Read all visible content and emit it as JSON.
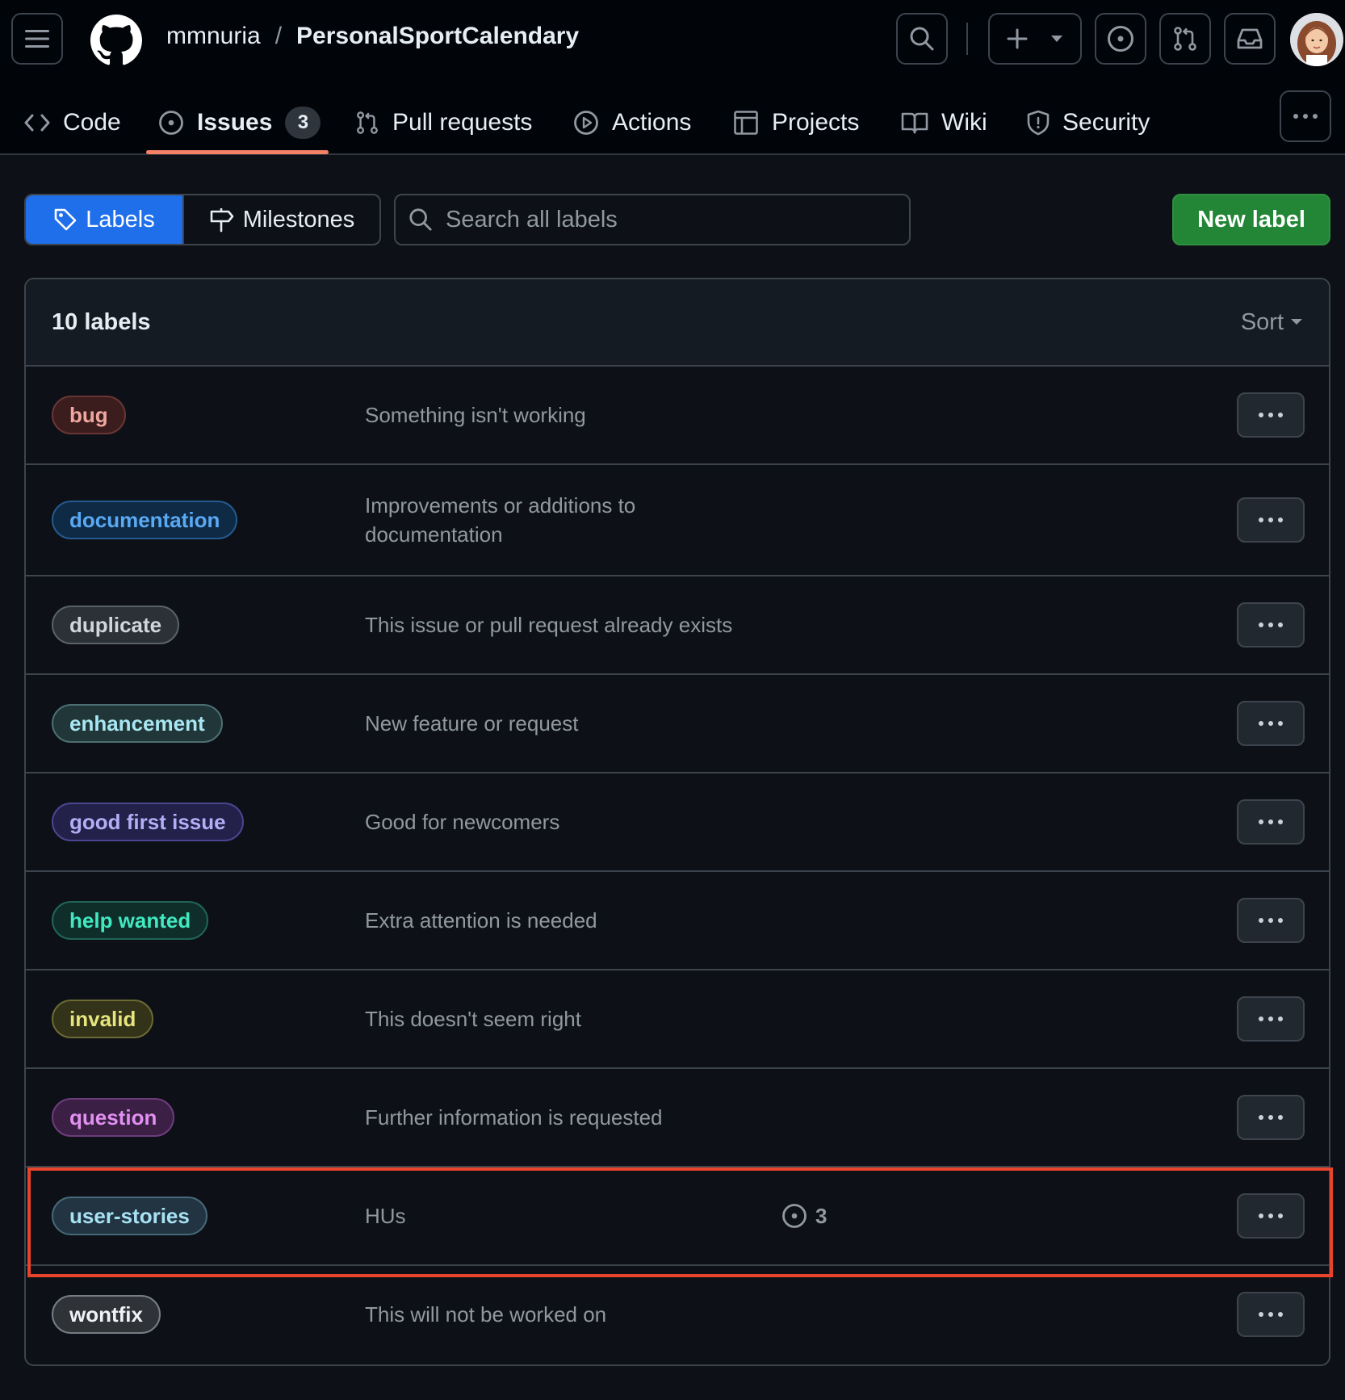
{
  "header": {
    "owner": "mmnuria",
    "separator": "/",
    "repo": "PersonalSportCalendary",
    "icons": [
      "hamburger-icon",
      "github-logo-icon",
      "search-icon",
      "plus-icon",
      "caret-down-icon",
      "issue-opened-icon",
      "git-pull-request-icon",
      "inbox-icon"
    ]
  },
  "tabs": [
    {
      "label": "Code",
      "icon": "code-icon"
    },
    {
      "label": "Issues",
      "icon": "issue-opened-icon",
      "count": "3"
    },
    {
      "label": "Pull requests",
      "icon": "git-pull-request-icon"
    },
    {
      "label": "Actions",
      "icon": "play-icon"
    },
    {
      "label": "Projects",
      "icon": "table-icon"
    },
    {
      "label": "Wiki",
      "icon": "book-icon"
    },
    {
      "label": "Security",
      "icon": "shield-icon"
    }
  ],
  "subnav": {
    "labels": "Labels",
    "milestones": "Milestones"
  },
  "search": {
    "placeholder": "Search all labels"
  },
  "new_label_button": "New label",
  "list": {
    "title": "10 labels",
    "sort": "Sort",
    "labels": [
      {
        "name": "bug",
        "description": "Something isn't working",
        "fg": "#f1a7a0",
        "bg": "#3b1d1e",
        "border": "#6b3536"
      },
      {
        "name": "documentation",
        "description": "Improvements or additions to documentation",
        "fg": "#5aa9f4",
        "bg": "#0f2a45",
        "border": "#245a8f"
      },
      {
        "name": "duplicate",
        "description": "This issue or pull request already exists",
        "fg": "#d2d6dc",
        "bg": "#2c3138",
        "border": "#5a616b"
      },
      {
        "name": "enhancement",
        "description": "New feature or request",
        "fg": "#a8e6f2",
        "bg": "#213638",
        "border": "#4d6f73"
      },
      {
        "name": "good first issue",
        "description": "Good for newcomers",
        "fg": "#b3aef5",
        "bg": "#23204a",
        "border": "#4c4590"
      },
      {
        "name": "help wanted",
        "description": "Extra attention is needed",
        "fg": "#41e8c0",
        "bg": "#0f2e2a",
        "border": "#1f6656"
      },
      {
        "name": "invalid",
        "description": "This doesn't seem right",
        "fg": "#e7e57c",
        "bg": "#33331a",
        "border": "#6b6a33"
      },
      {
        "name": "question",
        "description": "Further information is requested",
        "fg": "#e190ef",
        "bg": "#3b1f45",
        "border": "#6e3c7d"
      },
      {
        "name": "user-stories",
        "description": "HUs",
        "fg": "#a8e2f5",
        "bg": "#223441",
        "border": "#48687b",
        "issues": "3"
      },
      {
        "name": "wontfix",
        "description": "This will not be worked on",
        "fg": "#f0f3f6",
        "bg": "#2f3338",
        "border": "#777d85"
      }
    ]
  },
  "colors": {
    "accent_active_tab": "#f78166",
    "labels_tab_active": "#1f6feb",
    "new_label_green": "#238636",
    "highlight": "#e8432b"
  }
}
